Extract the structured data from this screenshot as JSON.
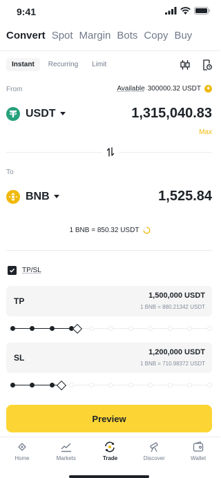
{
  "status_bar": {
    "time": "9:41"
  },
  "top_tabs": [
    {
      "label": "Convert",
      "active": true
    },
    {
      "label": "Spot"
    },
    {
      "label": "Margin"
    },
    {
      "label": "Bots"
    },
    {
      "label": "Copy"
    },
    {
      "label": "Buy"
    }
  ],
  "sub_tabs": [
    {
      "label": "Instant",
      "active": true
    },
    {
      "label": "Recurring"
    },
    {
      "label": "Limit"
    }
  ],
  "from": {
    "label": "From",
    "available_label": "Available",
    "available_value": "300000.32 USDT",
    "coin": "USDT",
    "amount": "1,315,040.83",
    "max_label": "Max"
  },
  "to": {
    "label": "To",
    "coin": "BNB",
    "amount": "1,525.84"
  },
  "rate": "1 BNB = 850.32 USDT",
  "tpsl": {
    "label": "TP/SL",
    "checked": true,
    "tp": {
      "label": "TP",
      "value": "1,500,000 USDT",
      "rate": "1 BNB = 880.21342 USDT",
      "slider_level": 0.33
    },
    "sl": {
      "label": "SL",
      "value": "1,200,000 USDT",
      "rate": "1 BNB = 710.98372 USDT",
      "slider_level": 0.25
    }
  },
  "preview_label": "Preview",
  "bottom_nav": [
    {
      "label": "Home",
      "icon": "home-icon"
    },
    {
      "label": "Markets",
      "icon": "markets-chart-icon"
    },
    {
      "label": "Trade",
      "icon": "trade-swap-icon",
      "active": true
    },
    {
      "label": "Discover",
      "icon": "telescope-icon"
    },
    {
      "label": "Wallet",
      "icon": "wallet-icon"
    }
  ],
  "colors": {
    "accent": "#fcd535",
    "brand_yellow": "#f0b90b",
    "usdt_green": "#26a17b",
    "text_primary": "#1e2329",
    "text_secondary": "#848e9c"
  }
}
